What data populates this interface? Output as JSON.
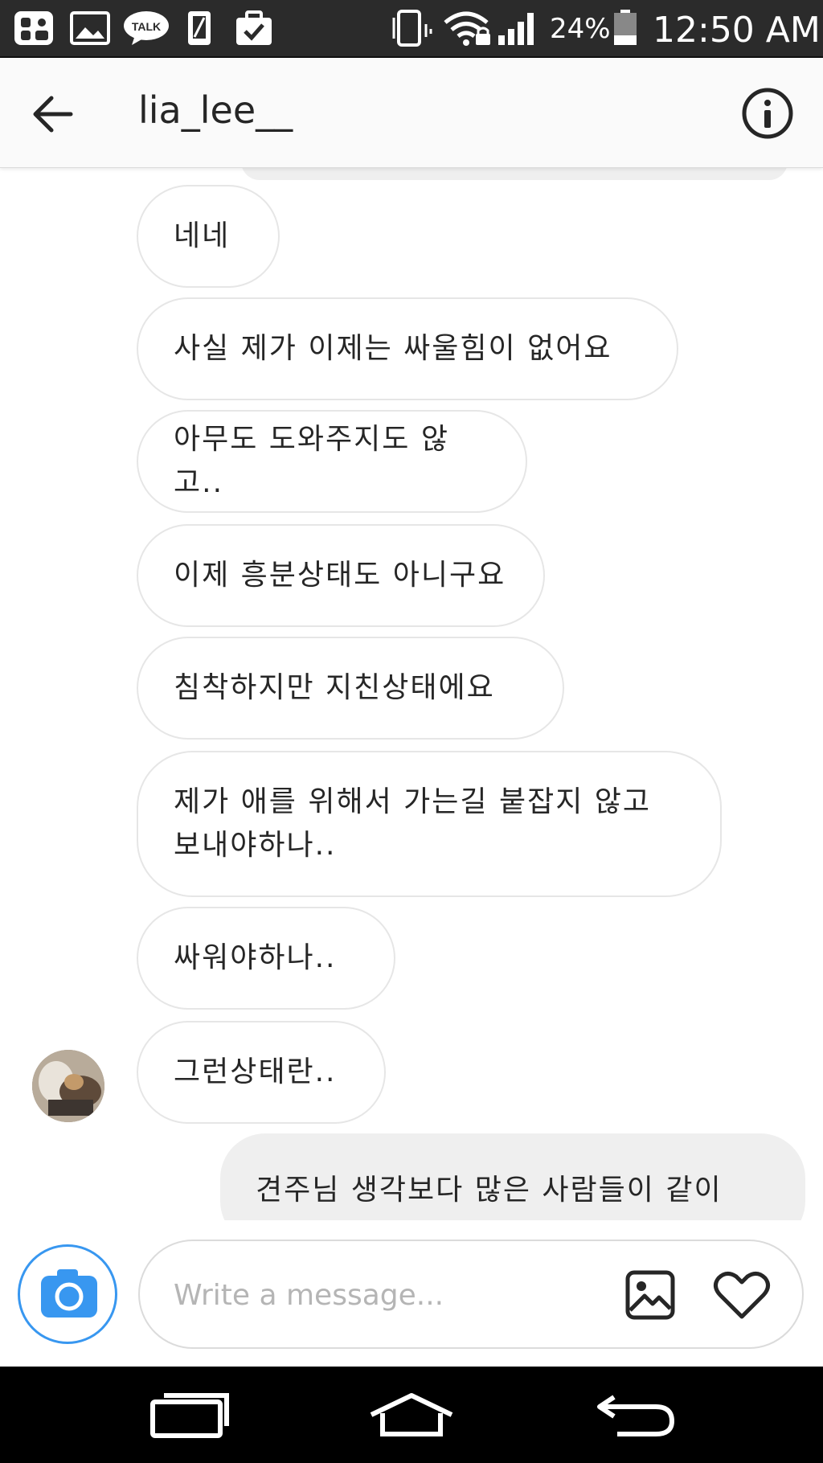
{
  "status_bar": {
    "battery_percent": "24%",
    "time": "12:50 AM",
    "notification_icons": [
      "profile-app-icon",
      "gallery-icon",
      "kakaotalk-icon",
      "phone-icon",
      "briefcase-check-icon"
    ],
    "talk_badge": "TALK"
  },
  "header": {
    "username": "lia_lee__",
    "back_icon": "arrow-left-icon",
    "info_icon": "info-icon"
  },
  "messages": [
    {
      "direction": "incoming",
      "text": "네네"
    },
    {
      "direction": "incoming",
      "text": "사실 제가 이제는 싸울힘이 없어요"
    },
    {
      "direction": "incoming",
      "text": "아무도 도와주지도 않고.."
    },
    {
      "direction": "incoming",
      "text": "이제 흥분상태도 아니구요"
    },
    {
      "direction": "incoming",
      "text": "침착하지만 지친상태에요"
    },
    {
      "direction": "incoming",
      "line1": "제가 애를 위해서 가는길 붙잡지 않고",
      "line2": "보내야하나.."
    },
    {
      "direction": "incoming",
      "text": "싸워야하나.."
    },
    {
      "direction": "incoming",
      "text": "그런상태란.."
    },
    {
      "direction": "outgoing",
      "text": "견주님 생각보다 많은 사람들이 같이"
    }
  ],
  "composer": {
    "placeholder": "Write a message...",
    "camera_icon": "camera-icon",
    "gallery_icon": "image-icon",
    "like_icon": "heart-icon",
    "accent_color": "#3897f0"
  },
  "nav_bar": {
    "icons": [
      "recent-apps-icon",
      "home-icon",
      "back-icon"
    ]
  }
}
